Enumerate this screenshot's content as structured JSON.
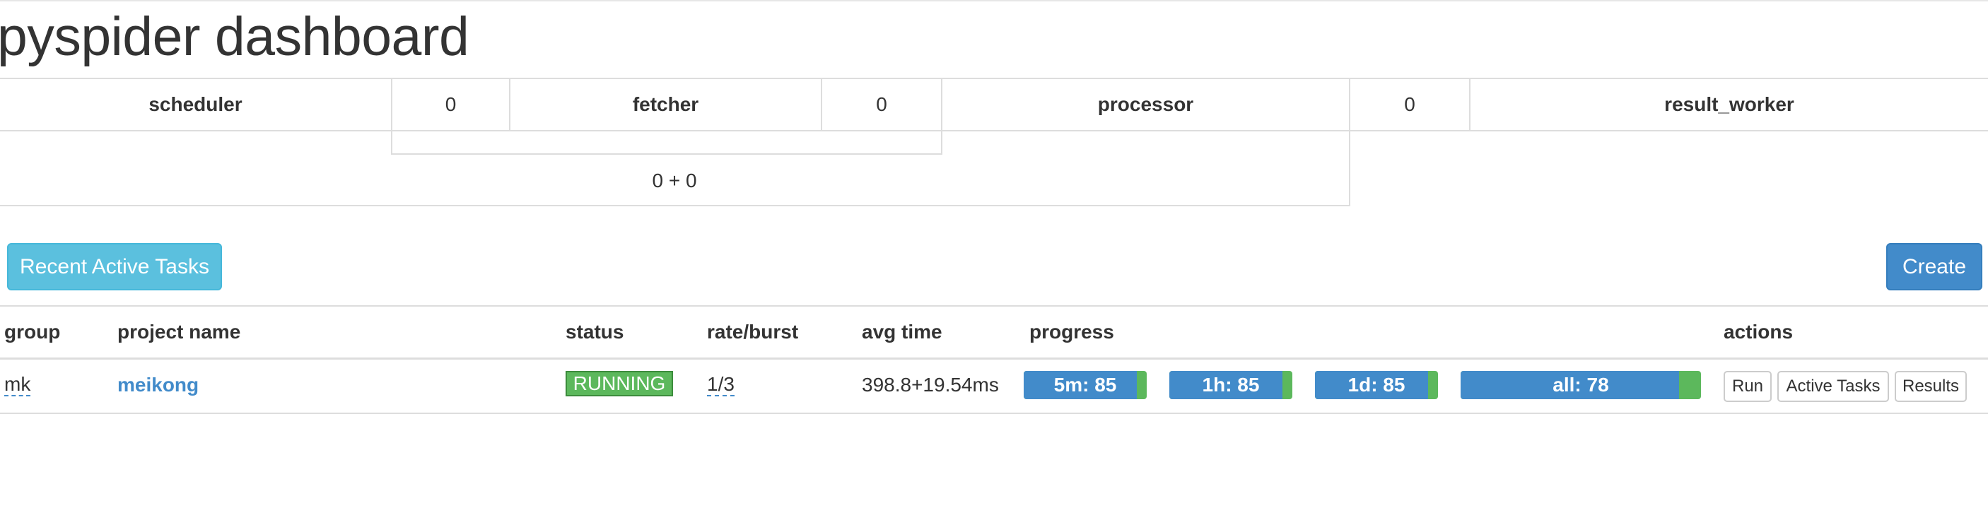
{
  "header": {
    "title": "pyspider dashboard"
  },
  "queues": {
    "scheduler_label": "scheduler",
    "scheduler_to_fetcher": "0",
    "fetcher_label": "fetcher",
    "fetcher_to_processor": "0",
    "processor_label": "processor",
    "processor_to_result": "0",
    "result_worker_label": "result_worker",
    "sum": "0 + 0"
  },
  "toolbar": {
    "recent_tasks_label": "Recent Active Tasks",
    "create_label": "Create"
  },
  "projects": {
    "columns": [
      "group",
      "project name",
      "status",
      "rate/burst",
      "avg time",
      "progress",
      "actions"
    ],
    "rows": [
      {
        "group": "mk",
        "name": "meikong",
        "status": "RUNNING",
        "rate_burst": "1/3",
        "avg_time": "398.8+19.54ms",
        "progress": [
          {
            "label": "5m: 85",
            "fraction": 0.92
          },
          {
            "label": "1h: 85",
            "fraction": 0.92
          },
          {
            "label": "1d: 85",
            "fraction": 0.92
          },
          {
            "label": "all: 78",
            "fraction": 0.91
          }
        ],
        "actions": [
          "Run",
          "Active Tasks",
          "Results"
        ]
      }
    ]
  },
  "colors": {
    "primary": "#428bca",
    "info": "#5bc0de",
    "success": "#5cb85c"
  }
}
